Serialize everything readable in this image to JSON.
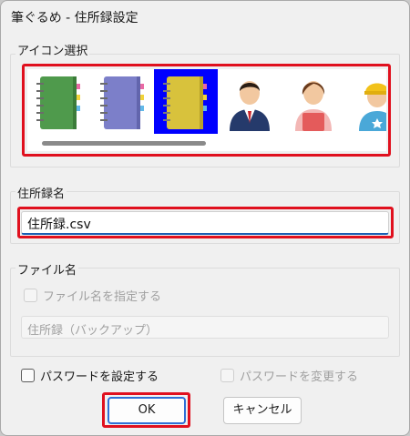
{
  "window": {
    "title": "筆ぐるめ - 住所録設定"
  },
  "icon_section": {
    "label": "アイコン選択",
    "icons": [
      {
        "name": "green-notebook-icon",
        "color": "#4f9a4c",
        "selected": false
      },
      {
        "name": "purple-notebook-icon",
        "color": "#7c7fc9",
        "selected": false
      },
      {
        "name": "yellow-notebook-icon",
        "color": "#d8c23c",
        "selected": true
      },
      {
        "name": "businessman-icon",
        "selected": false
      },
      {
        "name": "woman-apron-icon",
        "selected": false
      },
      {
        "name": "child-hat-icon",
        "selected": false
      }
    ],
    "selection_color": "#0000ff"
  },
  "addressbook_section": {
    "label": "住所録名",
    "value": "住所録.csv"
  },
  "file_section": {
    "label": "ファイル名",
    "specify_checkbox_label": "ファイル名を指定する",
    "filename_value": "住所録（バックアップ）"
  },
  "password": {
    "set_label": "パスワードを設定する",
    "change_label": "パスワードを変更する"
  },
  "buttons": {
    "ok": "OK",
    "cancel": "キャンセル"
  },
  "colors": {
    "highlight_red": "#e0101e",
    "focus_blue": "#1a5fb4"
  }
}
